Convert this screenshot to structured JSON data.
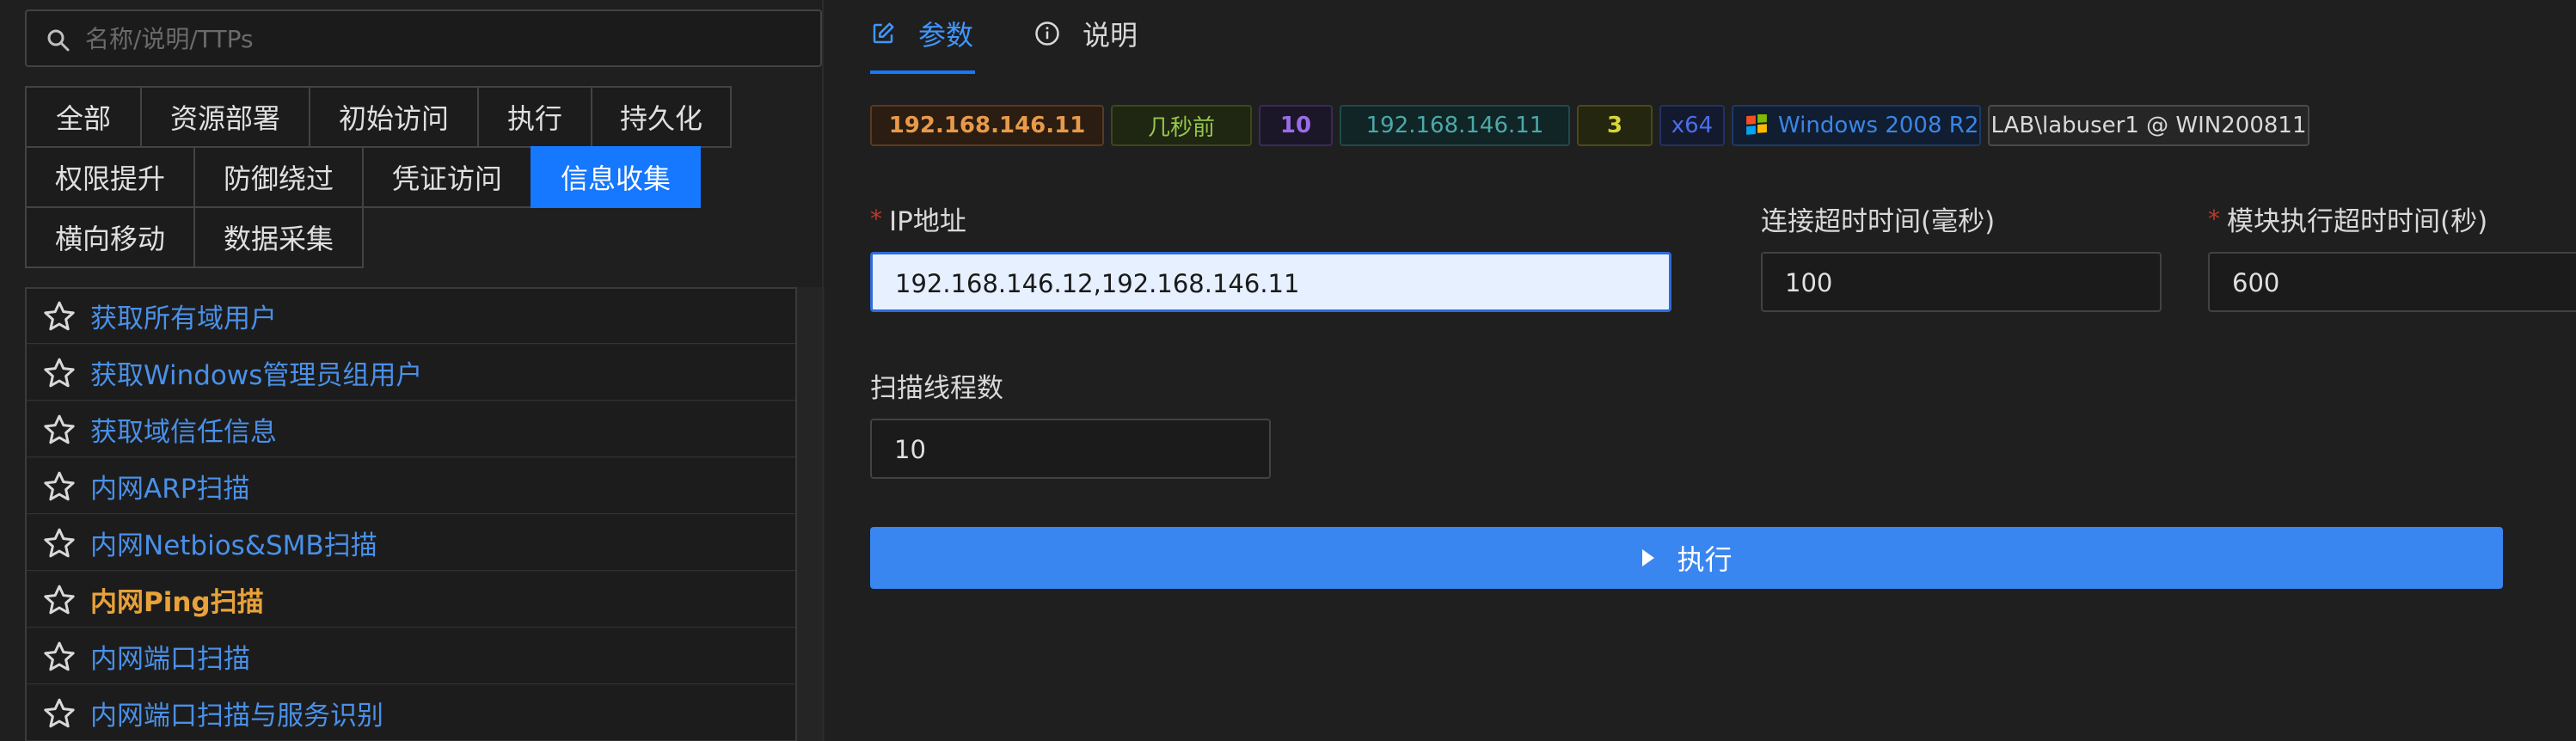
{
  "search": {
    "placeholder": "名称/说明/TTPs"
  },
  "categories": [
    [
      "全部",
      "资源部署",
      "初始访问",
      "执行",
      "持久化"
    ],
    [
      "权限提升",
      "防御绕过",
      "凭证访问",
      "信息收集"
    ],
    [
      "横向移动",
      "数据采集"
    ]
  ],
  "active_category": "信息收集",
  "modules": [
    "获取所有域用户",
    "获取Windows管理员组用户",
    "获取域信任信息",
    "内网ARP扫描",
    "内网Netbios&SMB扫描",
    "内网Ping扫描",
    "内网端口扫描",
    "内网端口扫描与服务识别"
  ],
  "highlighted_module": "内网Ping扫描",
  "tabs": {
    "params": "参数",
    "desc": "说明"
  },
  "session": {
    "ip": "192.168.146.11",
    "last_seen": "几秒前",
    "pid": "10",
    "ip_internal": "192.168.146.11",
    "count": "3",
    "arch": "x64",
    "os": "Windows 2008 R2",
    "user": "LAB\\labuser1 @ WIN200811"
  },
  "form": {
    "ip_label": "IP地址",
    "ip_value": "192.168.146.12,192.168.146.11",
    "timeout_label": "连接超时时间(毫秒)",
    "timeout_value": "100",
    "module_timeout_label": "模块执行超时时间(秒)",
    "module_timeout_value": "600",
    "threads_label": "扫描线程数",
    "threads_value": "10",
    "execute_label": "执行"
  },
  "colors": {
    "accent": "#1677ff",
    "highlight": "#e8a23a",
    "link": "#4a90e8",
    "required": "#c0392b"
  }
}
